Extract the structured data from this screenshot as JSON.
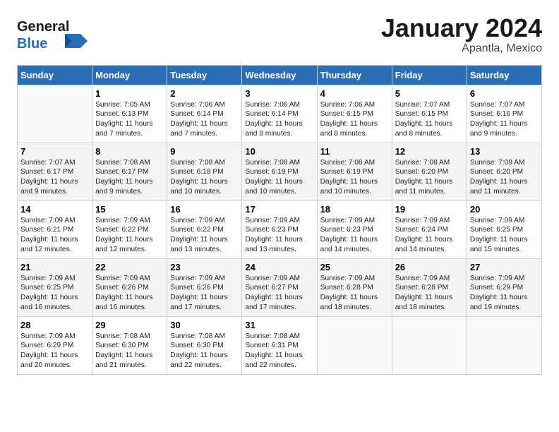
{
  "logo": {
    "line1": "General",
    "line2": "Blue"
  },
  "title": "January 2024",
  "subtitle": "Apantla, Mexico",
  "header_days": [
    "Sunday",
    "Monday",
    "Tuesday",
    "Wednesday",
    "Thursday",
    "Friday",
    "Saturday"
  ],
  "weeks": [
    [
      {
        "num": "",
        "info": ""
      },
      {
        "num": "1",
        "info": "Sunrise: 7:05 AM\nSunset: 6:13 PM\nDaylight: 11 hours\nand 7 minutes."
      },
      {
        "num": "2",
        "info": "Sunrise: 7:06 AM\nSunset: 6:14 PM\nDaylight: 11 hours\nand 7 minutes."
      },
      {
        "num": "3",
        "info": "Sunrise: 7:06 AM\nSunset: 6:14 PM\nDaylight: 11 hours\nand 8 minutes."
      },
      {
        "num": "4",
        "info": "Sunrise: 7:06 AM\nSunset: 6:15 PM\nDaylight: 11 hours\nand 8 minutes."
      },
      {
        "num": "5",
        "info": "Sunrise: 7:07 AM\nSunset: 6:15 PM\nDaylight: 11 hours\nand 8 minutes."
      },
      {
        "num": "6",
        "info": "Sunrise: 7:07 AM\nSunset: 6:16 PM\nDaylight: 11 hours\nand 9 minutes."
      }
    ],
    [
      {
        "num": "7",
        "info": "Sunrise: 7:07 AM\nSunset: 6:17 PM\nDaylight: 11 hours\nand 9 minutes."
      },
      {
        "num": "8",
        "info": "Sunrise: 7:08 AM\nSunset: 6:17 PM\nDaylight: 11 hours\nand 9 minutes."
      },
      {
        "num": "9",
        "info": "Sunrise: 7:08 AM\nSunset: 6:18 PM\nDaylight: 11 hours\nand 10 minutes."
      },
      {
        "num": "10",
        "info": "Sunrise: 7:08 AM\nSunset: 6:19 PM\nDaylight: 11 hours\nand 10 minutes."
      },
      {
        "num": "11",
        "info": "Sunrise: 7:08 AM\nSunset: 6:19 PM\nDaylight: 11 hours\nand 10 minutes."
      },
      {
        "num": "12",
        "info": "Sunrise: 7:08 AM\nSunset: 6:20 PM\nDaylight: 11 hours\nand 11 minutes."
      },
      {
        "num": "13",
        "info": "Sunrise: 7:09 AM\nSunset: 6:20 PM\nDaylight: 11 hours\nand 11 minutes."
      }
    ],
    [
      {
        "num": "14",
        "info": "Sunrise: 7:09 AM\nSunset: 6:21 PM\nDaylight: 11 hours\nand 12 minutes."
      },
      {
        "num": "15",
        "info": "Sunrise: 7:09 AM\nSunset: 6:22 PM\nDaylight: 11 hours\nand 12 minutes."
      },
      {
        "num": "16",
        "info": "Sunrise: 7:09 AM\nSunset: 6:22 PM\nDaylight: 11 hours\nand 13 minutes."
      },
      {
        "num": "17",
        "info": "Sunrise: 7:09 AM\nSunset: 6:23 PM\nDaylight: 11 hours\nand 13 minutes."
      },
      {
        "num": "18",
        "info": "Sunrise: 7:09 AM\nSunset: 6:23 PM\nDaylight: 11 hours\nand 14 minutes."
      },
      {
        "num": "19",
        "info": "Sunrise: 7:09 AM\nSunset: 6:24 PM\nDaylight: 11 hours\nand 14 minutes."
      },
      {
        "num": "20",
        "info": "Sunrise: 7:09 AM\nSunset: 6:25 PM\nDaylight: 11 hours\nand 15 minutes."
      }
    ],
    [
      {
        "num": "21",
        "info": "Sunrise: 7:09 AM\nSunset: 6:25 PM\nDaylight: 11 hours\nand 16 minutes."
      },
      {
        "num": "22",
        "info": "Sunrise: 7:09 AM\nSunset: 6:26 PM\nDaylight: 11 hours\nand 16 minutes."
      },
      {
        "num": "23",
        "info": "Sunrise: 7:09 AM\nSunset: 6:26 PM\nDaylight: 11 hours\nand 17 minutes."
      },
      {
        "num": "24",
        "info": "Sunrise: 7:09 AM\nSunset: 6:27 PM\nDaylight: 11 hours\nand 17 minutes."
      },
      {
        "num": "25",
        "info": "Sunrise: 7:09 AM\nSunset: 6:28 PM\nDaylight: 11 hours\nand 18 minutes."
      },
      {
        "num": "26",
        "info": "Sunrise: 7:09 AM\nSunset: 6:28 PM\nDaylight: 11 hours\nand 18 minutes."
      },
      {
        "num": "27",
        "info": "Sunrise: 7:09 AM\nSunset: 6:29 PM\nDaylight: 11 hours\nand 19 minutes."
      }
    ],
    [
      {
        "num": "28",
        "info": "Sunrise: 7:09 AM\nSunset: 6:29 PM\nDaylight: 11 hours\nand 20 minutes."
      },
      {
        "num": "29",
        "info": "Sunrise: 7:08 AM\nSunset: 6:30 PM\nDaylight: 11 hours\nand 21 minutes."
      },
      {
        "num": "30",
        "info": "Sunrise: 7:08 AM\nSunset: 6:30 PM\nDaylight: 11 hours\nand 22 minutes."
      },
      {
        "num": "31",
        "info": "Sunrise: 7:08 AM\nSunset: 6:31 PM\nDaylight: 11 hours\nand 22 minutes."
      },
      {
        "num": "",
        "info": ""
      },
      {
        "num": "",
        "info": ""
      },
      {
        "num": "",
        "info": ""
      }
    ]
  ]
}
